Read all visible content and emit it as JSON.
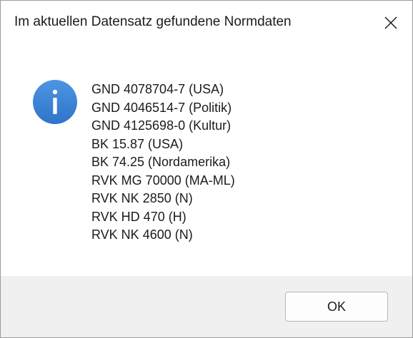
{
  "window": {
    "title": "Im aktuellen Datensatz gefundene Normdaten",
    "close_icon": "close-icon"
  },
  "message": {
    "icon": "info-icon",
    "icon_color": "#3b82d6",
    "lines": [
      "GND 4078704-7 (USA)",
      "GND 4046514-7 (Politik)",
      "GND 4125698-0 (Kultur)",
      "BK 15.87 (USA)",
      "BK 74.25 (Nordamerika)",
      "RVK MG 70000 (MA-ML)",
      "RVK NK 2850 (N)",
      "RVK HD 470 (H)",
      "RVK NK 4600 (N)"
    ]
  },
  "footer": {
    "ok_label": "OK"
  }
}
